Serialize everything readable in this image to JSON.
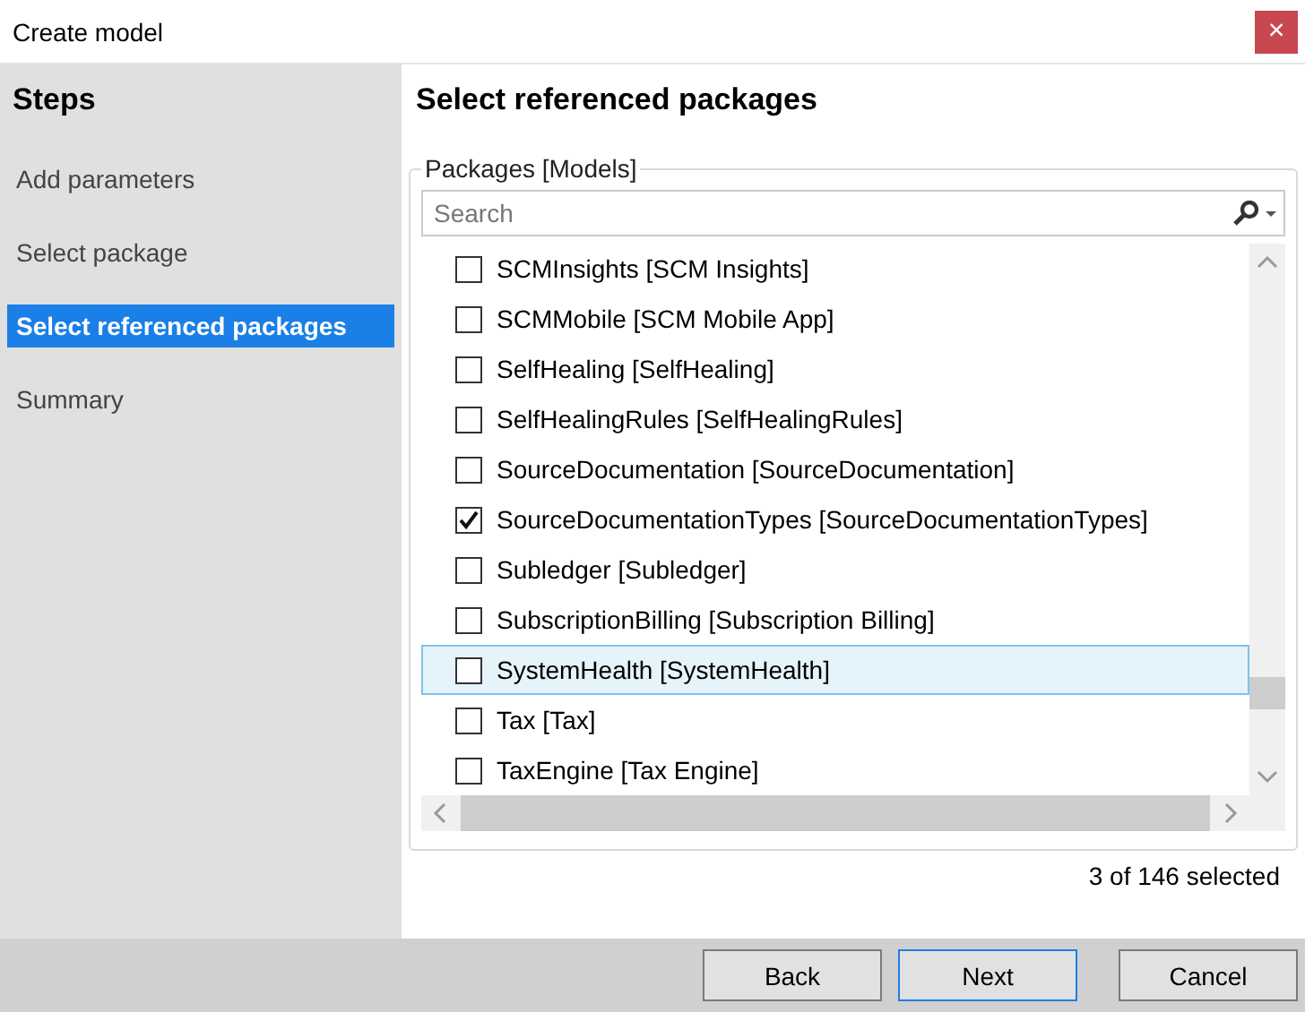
{
  "window": {
    "title": "Create model",
    "close": "×"
  },
  "sidebar": {
    "title": "Steps",
    "items": [
      {
        "label": "Add parameters",
        "selected": false
      },
      {
        "label": "Select package",
        "selected": false
      },
      {
        "label": "Select referenced packages",
        "selected": true
      },
      {
        "label": "Summary",
        "selected": false
      }
    ]
  },
  "content": {
    "title": "Select referenced packages",
    "group_label": "Packages [Models]",
    "search": {
      "placeholder": "Search"
    },
    "packages": [
      {
        "label": "SCMInsights [SCM Insights]",
        "checked": false,
        "highlighted": false
      },
      {
        "label": "SCMMobile [SCM Mobile App]",
        "checked": false,
        "highlighted": false
      },
      {
        "label": "SelfHealing [SelfHealing]",
        "checked": false,
        "highlighted": false
      },
      {
        "label": "SelfHealingRules [SelfHealingRules]",
        "checked": false,
        "highlighted": false
      },
      {
        "label": "SourceDocumentation [SourceDocumentation]",
        "checked": false,
        "highlighted": false
      },
      {
        "label": "SourceDocumentationTypes [SourceDocumentationTypes]",
        "checked": true,
        "highlighted": false
      },
      {
        "label": "Subledger [Subledger]",
        "checked": false,
        "highlighted": false
      },
      {
        "label": "SubscriptionBilling [Subscription Billing]",
        "checked": false,
        "highlighted": false
      },
      {
        "label": "SystemHealth [SystemHealth]",
        "checked": false,
        "highlighted": true
      },
      {
        "label": "Tax [Tax]",
        "checked": false,
        "highlighted": false
      },
      {
        "label": "TaxEngine [Tax Engine]",
        "checked": false,
        "highlighted": false
      }
    ],
    "selection_count": "3 of 146 selected"
  },
  "buttons": [
    {
      "label": "Back",
      "default": false
    },
    {
      "label": "Next",
      "default": true
    },
    {
      "label": "Cancel",
      "default": false
    }
  ]
}
